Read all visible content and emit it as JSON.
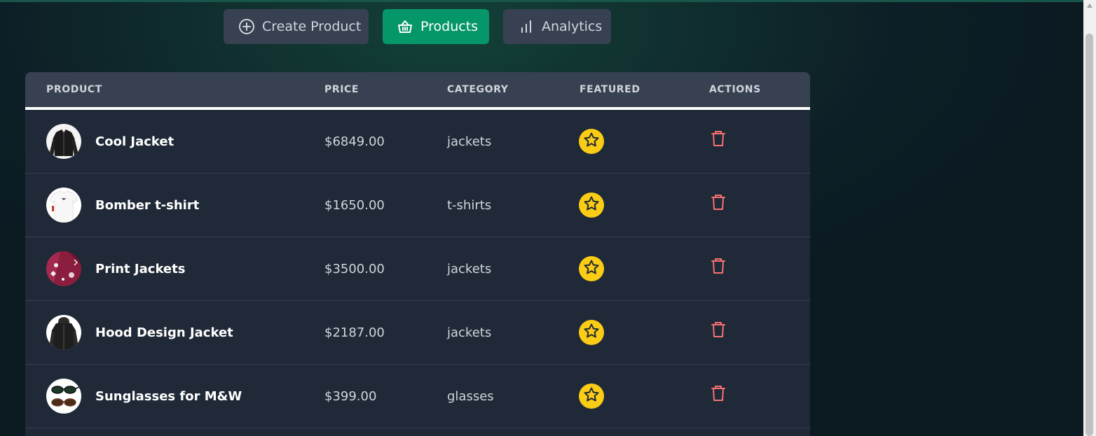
{
  "nav": {
    "tabs": [
      {
        "label": "Create Product",
        "icon": "plus-circle-icon",
        "active": false
      },
      {
        "label": "Products",
        "icon": "basket-icon",
        "active": true
      },
      {
        "label": "Analytics",
        "icon": "bar-chart-icon",
        "active": false
      }
    ]
  },
  "table": {
    "headers": {
      "product": "Product",
      "price": "Price",
      "category": "Category",
      "featured": "Featured",
      "actions": "Actions"
    },
    "rows": [
      {
        "name": "Cool Jacket",
        "price": "$6849.00",
        "category": "jackets",
        "featured": true
      },
      {
        "name": "Bomber t-shirt",
        "price": "$1650.00",
        "category": "t-shirts",
        "featured": true
      },
      {
        "name": "Print Jackets",
        "price": "$3500.00",
        "category": "jackets",
        "featured": true
      },
      {
        "name": "Hood Design Jacket",
        "price": "$2187.00",
        "category": "jackets",
        "featured": true
      },
      {
        "name": "Sunglasses for M&W",
        "price": "$399.00",
        "category": "glasses",
        "featured": true
      }
    ]
  },
  "colors": {
    "accent": "#059669",
    "tab_bg": "#374151",
    "table_bg": "#1f2937",
    "star": "#facc15",
    "trash": "#f87171"
  }
}
